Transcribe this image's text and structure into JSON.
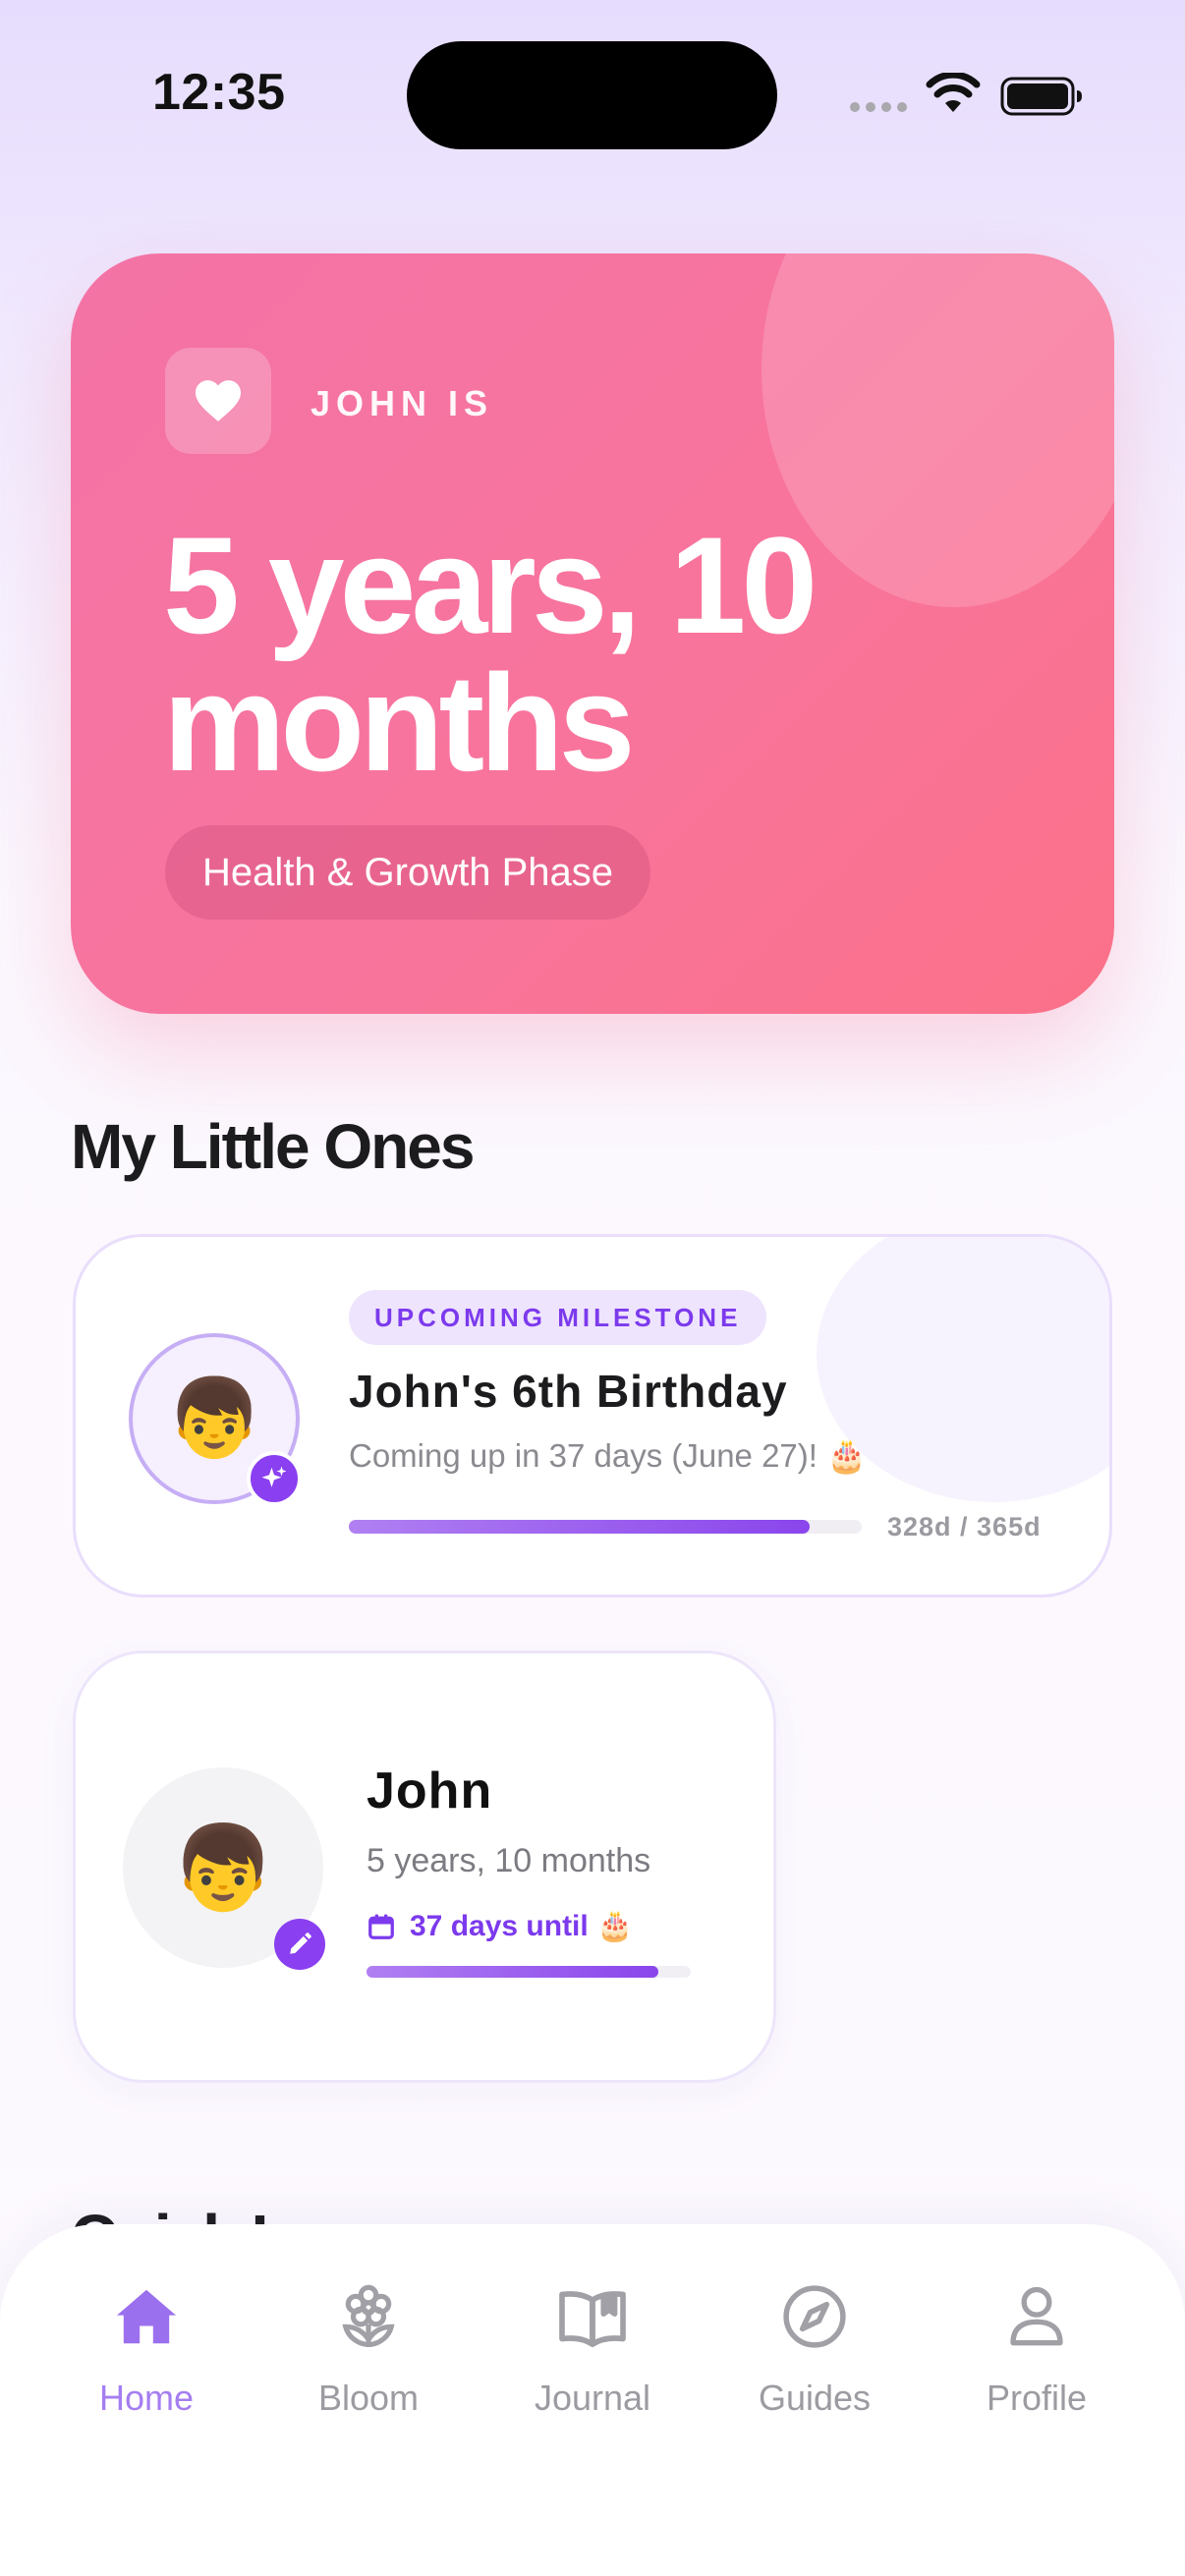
{
  "status_bar": {
    "time": "12:35"
  },
  "hero": {
    "label": "JOHN IS",
    "age": "5 years, 10 months",
    "phase": "Health & Growth Phase",
    "icon": "heart-icon",
    "colors": {
      "from": "#f373a6",
      "to": "#fb7189"
    }
  },
  "section": {
    "title": "My Little Ones",
    "next_title": "Quick L"
  },
  "milestone": {
    "tag": "UPCOMING MILESTONE",
    "title": "John's 6th Birthday",
    "subtitle": "Coming up in 37 days (June 27)! 🎂",
    "progress": 0.899,
    "count": "328d / 365d",
    "avatar": "👦"
  },
  "child": {
    "name": "John",
    "age": "5 years, 10 months",
    "until": "37 days until 🎂",
    "progress": 0.899,
    "avatar": "👦"
  },
  "tabs": [
    {
      "label": "Home",
      "icon": "home-icon",
      "active": true
    },
    {
      "label": "Bloom",
      "icon": "flower-icon",
      "active": false
    },
    {
      "label": "Journal",
      "icon": "book-icon",
      "active": false
    },
    {
      "label": "Guides",
      "icon": "compass-icon",
      "active": false
    },
    {
      "label": "Profile",
      "icon": "person-icon",
      "active": false
    }
  ],
  "accent": "#8a3ff0"
}
